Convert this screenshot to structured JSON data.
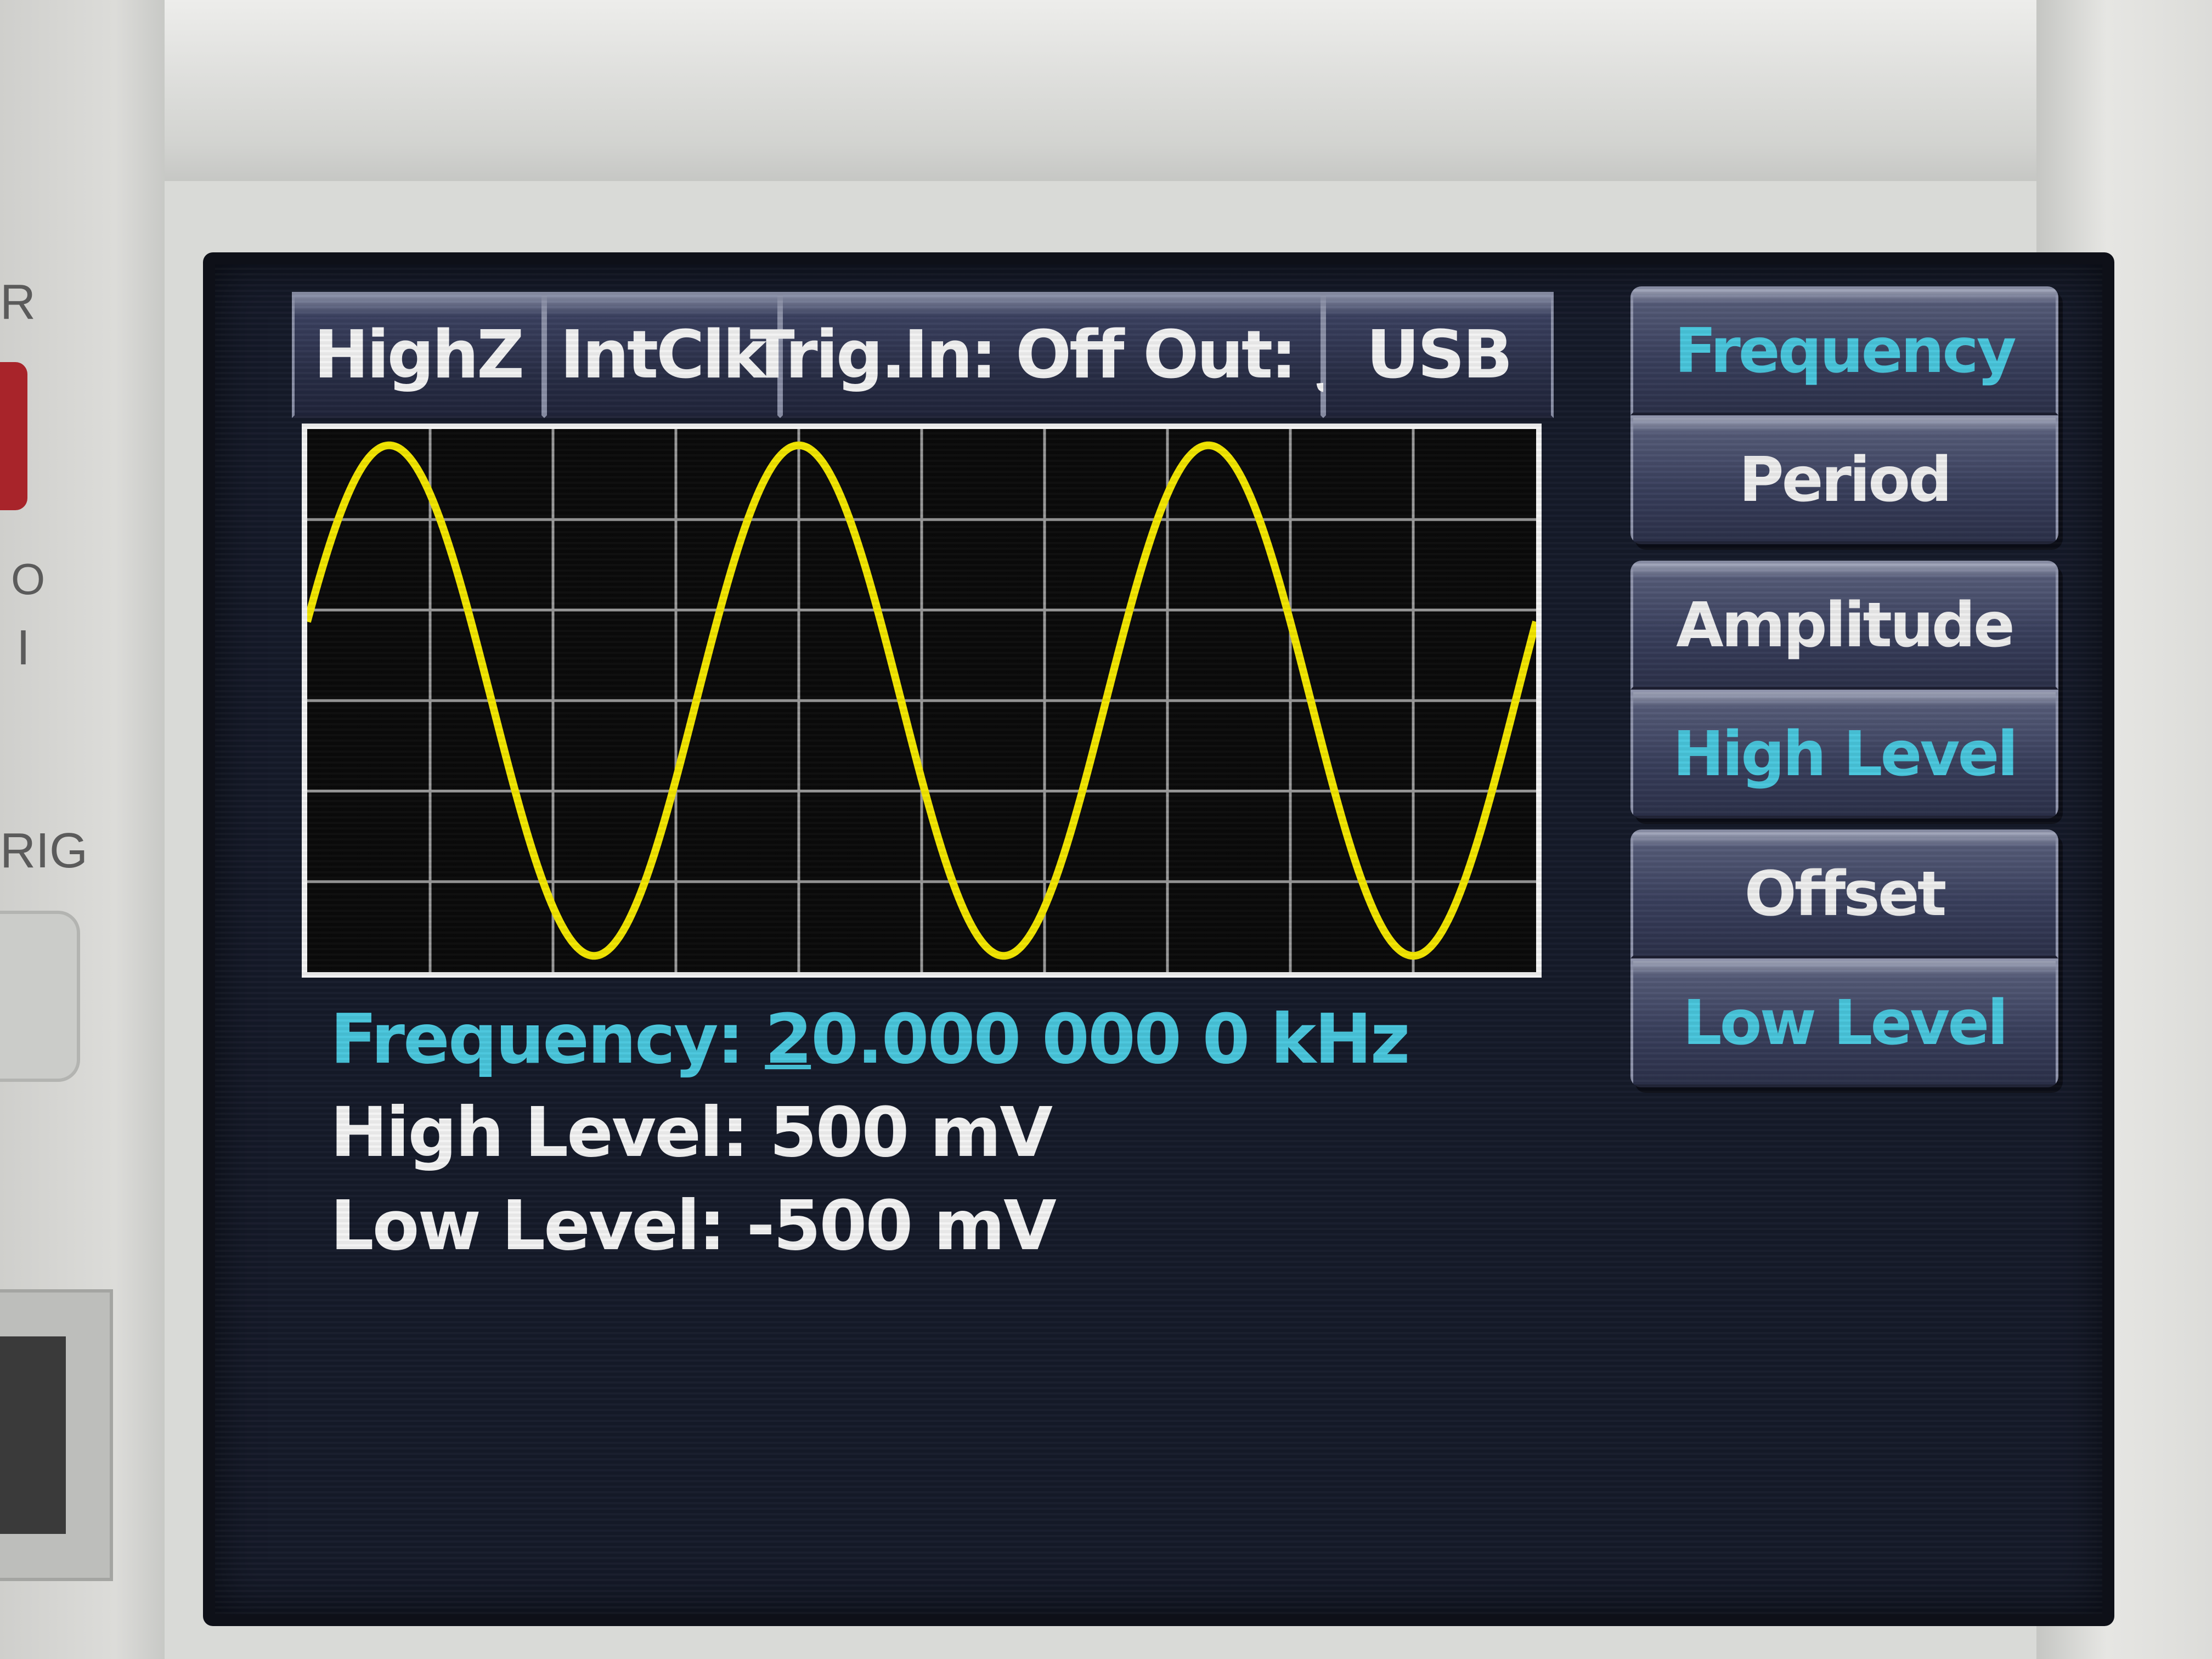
{
  "bezel": {
    "left_labels": [
      "R",
      "O",
      "I",
      "RIG"
    ]
  },
  "status_bar": {
    "load": "HighZ",
    "clock": "IntClk",
    "trigger_output": "Trig.In: Off Out: ∫",
    "interface": "USB"
  },
  "waveform": {
    "type": "sine",
    "cycles_shown": 3,
    "color": "#f2e600"
  },
  "readout": {
    "frequency_label": "Frequency:",
    "frequency_value_digit": "2",
    "frequency_value_rest": "0.000 000 0 kHz",
    "high_label": "High Level:",
    "high_value": "500 mV",
    "low_label": "Low Level:",
    "low_value": "-500 mV"
  },
  "softkeys": {
    "frequency": "Frequency",
    "period": "Period",
    "amplitude": "Amplitude",
    "high_level": "High Level",
    "offset": "Offset",
    "low_level": "Low Level"
  },
  "colors": {
    "screen_bg": "#151a29",
    "highlight_cyan": "#49c6dc",
    "trace_yellow": "#f2e600"
  }
}
